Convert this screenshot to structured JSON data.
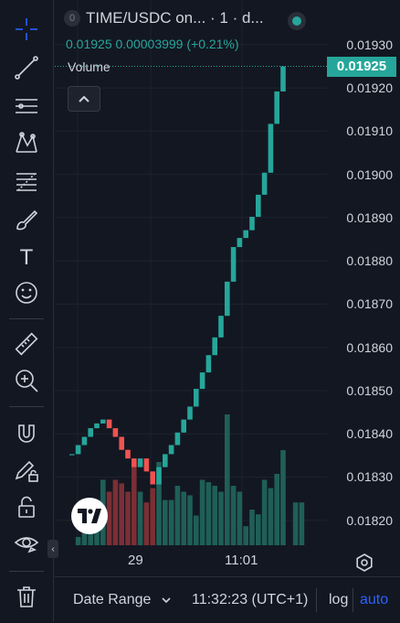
{
  "toolbar": {
    "items": [
      {
        "name": "crosshair-icon"
      },
      {
        "name": "trend-line-icon"
      },
      {
        "name": "horizontal-lines-icon"
      },
      {
        "name": "pattern-icon"
      },
      {
        "name": "fib-retracement-icon"
      },
      {
        "name": "brush-icon"
      },
      {
        "name": "text-icon",
        "glyph": "T"
      },
      {
        "name": "emoji-icon"
      },
      {
        "name": "ruler-icon"
      },
      {
        "name": "zoom-in-icon"
      },
      {
        "name": "magnet-icon"
      },
      {
        "name": "lock-drawing-icon"
      },
      {
        "name": "lock-icon"
      },
      {
        "name": "eye-icon"
      },
      {
        "name": "trash-icon"
      }
    ]
  },
  "legend": {
    "badge": "0",
    "title": "TIME/USDC on... · 1 · d...",
    "ohlc": "0.01925  0.00003999 (+0.21%)",
    "volume_label": "Volume"
  },
  "price_axis": {
    "labels": [
      "0.01930",
      "0.01920",
      "0.01910",
      "0.01900",
      "0.01890",
      "0.01880",
      "0.01870",
      "0.01860",
      "0.01850",
      "0.01840",
      "0.01830",
      "0.01820"
    ],
    "last_price": "0.01925"
  },
  "time_axis": {
    "labels": [
      "29",
      "11:01"
    ]
  },
  "bottom_bar": {
    "date_range": "Date Range",
    "time": "11:32:23 (UTC+1)",
    "log": "log",
    "auto": "auto"
  },
  "colors": {
    "up": "#26a69a",
    "down": "#ef5350",
    "background": "#131722",
    "grid": "#1e222d",
    "accent": "#2962ff"
  },
  "chart_data": {
    "type": "candlestick",
    "y_range": [
      0.018155,
      0.01934
    ],
    "last_price": 0.01925,
    "candles": [
      {
        "o": 0.018353,
        "h": 0.018353,
        "l": 0.018353,
        "c": 0.018353
      },
      {
        "o": 0.018353,
        "h": 0.018374,
        "l": 0.018353,
        "c": 0.018374
      },
      {
        "o": 0.018374,
        "h": 0.018393,
        "l": 0.018374,
        "c": 0.018393
      },
      {
        "o": 0.018393,
        "h": 0.018413,
        "l": 0.018393,
        "c": 0.018413
      },
      {
        "o": 0.018413,
        "h": 0.018424,
        "l": 0.018413,
        "c": 0.018424
      },
      {
        "o": 0.018424,
        "h": 0.018433,
        "l": 0.018424,
        "c": 0.018433
      },
      {
        "o": 0.018433,
        "h": 0.018433,
        "l": 0.018413,
        "c": 0.018413
      },
      {
        "o": 0.018413,
        "h": 0.018413,
        "l": 0.018393,
        "c": 0.018393
      },
      {
        "o": 0.018393,
        "h": 0.018393,
        "l": 0.018363,
        "c": 0.018363
      },
      {
        "o": 0.018363,
        "h": 0.018363,
        "l": 0.018343,
        "c": 0.018343
      },
      {
        "o": 0.018343,
        "h": 0.018343,
        "l": 0.018323,
        "c": 0.018323
      },
      {
        "o": 0.018323,
        "h": 0.018343,
        "l": 0.018323,
        "c": 0.018343
      },
      {
        "o": 0.018343,
        "h": 0.018343,
        "l": 0.018313,
        "c": 0.018313
      },
      {
        "o": 0.018313,
        "h": 0.018313,
        "l": 0.018283,
        "c": 0.018283
      },
      {
        "o": 0.018283,
        "h": 0.018323,
        "l": 0.018283,
        "c": 0.018323
      },
      {
        "o": 0.018323,
        "h": 0.018353,
        "l": 0.018323,
        "c": 0.018353
      },
      {
        "o": 0.018353,
        "h": 0.018374,
        "l": 0.018353,
        "c": 0.018374
      },
      {
        "o": 0.018374,
        "h": 0.018403,
        "l": 0.018374,
        "c": 0.018403
      },
      {
        "o": 0.018403,
        "h": 0.018433,
        "l": 0.018403,
        "c": 0.018433
      },
      {
        "o": 0.018433,
        "h": 0.018463,
        "l": 0.018433,
        "c": 0.018463
      },
      {
        "o": 0.018463,
        "h": 0.018504,
        "l": 0.018463,
        "c": 0.018504
      },
      {
        "o": 0.018504,
        "h": 0.018542,
        "l": 0.018504,
        "c": 0.018542
      },
      {
        "o": 0.018542,
        "h": 0.018582,
        "l": 0.018542,
        "c": 0.018582
      },
      {
        "o": 0.018582,
        "h": 0.018623,
        "l": 0.018582,
        "c": 0.018623
      },
      {
        "o": 0.018623,
        "h": 0.018673,
        "l": 0.018623,
        "c": 0.018673
      },
      {
        "o": 0.018673,
        "h": 0.018752,
        "l": 0.018673,
        "c": 0.018752
      },
      {
        "o": 0.018752,
        "h": 0.018832,
        "l": 0.018752,
        "c": 0.018832
      },
      {
        "o": 0.018832,
        "h": 0.018853,
        "l": 0.018832,
        "c": 0.018853
      },
      {
        "o": 0.018853,
        "h": 0.018871,
        "l": 0.018853,
        "c": 0.018871
      },
      {
        "o": 0.018871,
        "h": 0.018902,
        "l": 0.018871,
        "c": 0.018902
      },
      {
        "o": 0.018902,
        "h": 0.018953,
        "l": 0.018902,
        "c": 0.018953
      },
      {
        "o": 0.018953,
        "h": 0.019004,
        "l": 0.018953,
        "c": 0.019004
      },
      {
        "o": 0.019004,
        "h": 0.019117,
        "l": 0.019004,
        "c": 0.019117
      },
      {
        "o": 0.019117,
        "h": 0.019192,
        "l": 0.019117,
        "c": 0.019192
      },
      {
        "o": 0.019192,
        "h": 0.01925,
        "l": 0.019192,
        "c": 0.01925
      }
    ],
    "volume": [
      0,
      0.07,
      0.1,
      0.26,
      0.38,
      0.55,
      0.45,
      0.55,
      0.52,
      0.45,
      0.7,
      0.45,
      0.36,
      0.48,
      0.7,
      0.38,
      0.38,
      0.5,
      0.45,
      0.42,
      0.25,
      0.55,
      0.53,
      0.5,
      0.45,
      1.1,
      0.5,
      0.45,
      0.16,
      0.3,
      0.26,
      0.55,
      0.48,
      0.6,
      0.8,
      0,
      0.36,
      0.36
    ]
  }
}
